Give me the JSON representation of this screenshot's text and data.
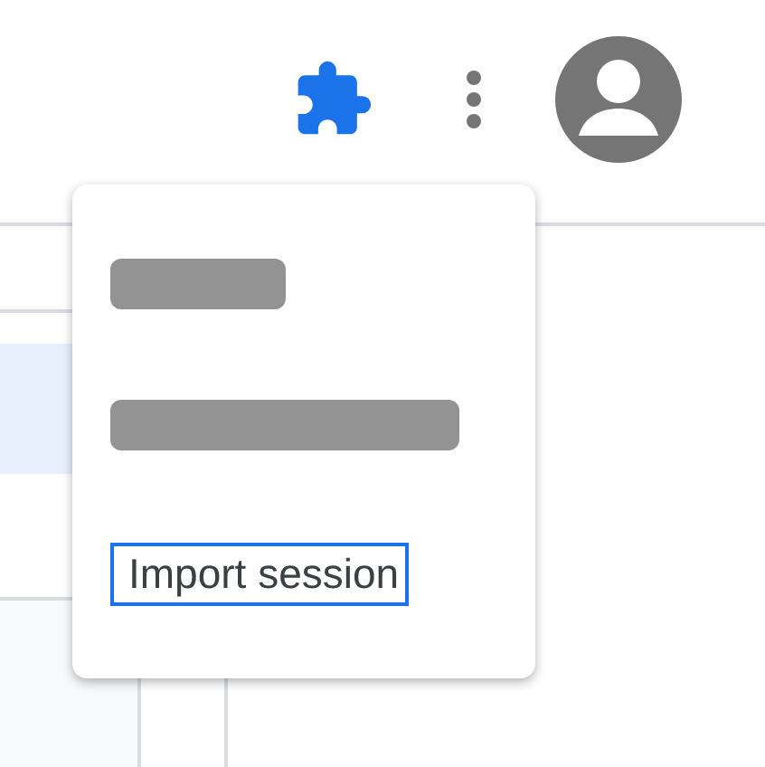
{
  "menu": {
    "items": [
      {
        "kind": "short"
      },
      {
        "kind": "long"
      },
      {
        "kind": "text",
        "label": "Import session",
        "focused": true
      }
    ]
  }
}
